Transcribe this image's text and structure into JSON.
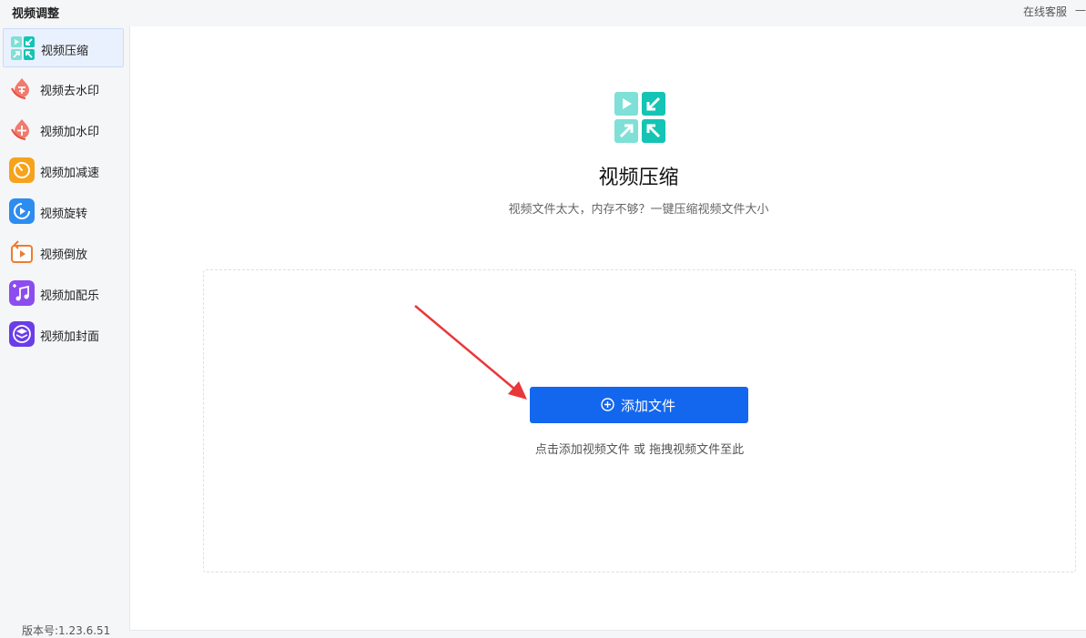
{
  "titlebar": {
    "title": "视频调整",
    "support": "在线客服",
    "minimize": "—"
  },
  "sidebar": {
    "items": [
      {
        "label": "视频压缩",
        "icon": "compress-icon",
        "active": true
      },
      {
        "label": "视频去水印",
        "icon": "watermark-remove-icon"
      },
      {
        "label": "视频加水印",
        "icon": "watermark-add-icon"
      },
      {
        "label": "视频加减速",
        "icon": "speed-icon"
      },
      {
        "label": "视频旋转",
        "icon": "rotate-icon"
      },
      {
        "label": "视频倒放",
        "icon": "reverse-icon"
      },
      {
        "label": "视频加配乐",
        "icon": "music-icon"
      },
      {
        "label": "视频加封面",
        "icon": "cover-icon"
      }
    ],
    "version": "版本号:1.23.6.51"
  },
  "main": {
    "title": "视频压缩",
    "subtitle": "视频文件太大，内存不够？一键压缩视频文件大小",
    "add_button": "添加文件",
    "drop_hint": "点击添加视频文件 或 拖拽视频文件至此"
  },
  "colors": {
    "primary": "#1367ee",
    "teal": "#14c4b4",
    "teal_light": "#7ee0d6",
    "arrow": "#e8383a"
  }
}
